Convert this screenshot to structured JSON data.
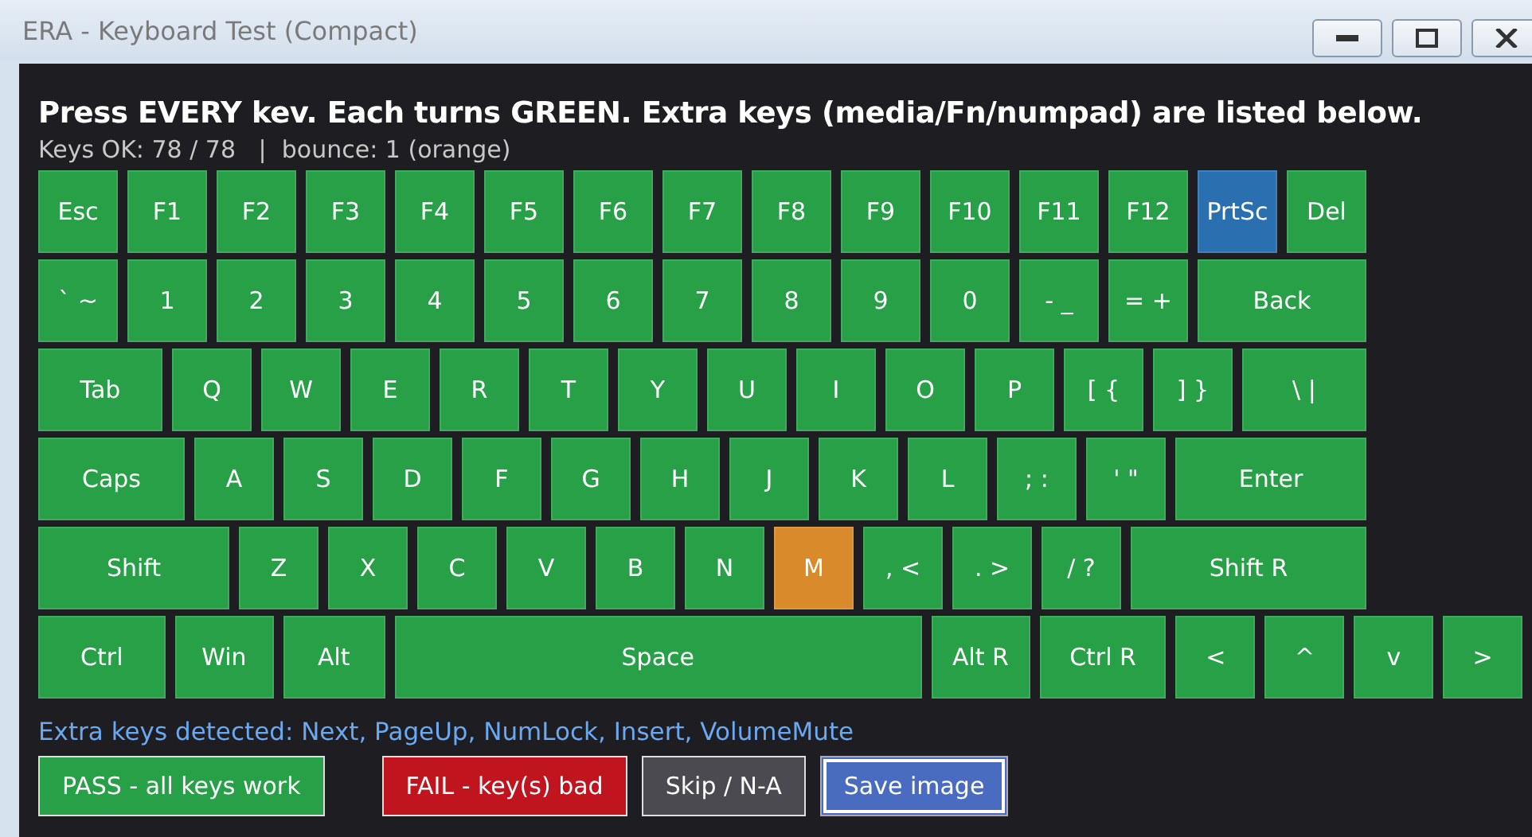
{
  "window": {
    "title": "ERA - Keyboard Test (Compact)"
  },
  "heading": "Press EVERY kev. Each turns GREEN. Extra keys (media/Fn/numpad) are listed below.",
  "status": "Keys OK: 78 / 78   |  bounce: 1 (orange)",
  "keyboard": {
    "rows": [
      {
        "keys": [
          {
            "label": "Esc",
            "color": "#27a047"
          },
          {
            "label": "F1",
            "color": "#27a047"
          },
          {
            "label": "F2",
            "color": "#27a047"
          },
          {
            "label": "F3",
            "color": "#27a047"
          },
          {
            "label": "F4",
            "color": "#27a047"
          },
          {
            "label": "F5",
            "color": "#27a047"
          },
          {
            "label": "F6",
            "color": "#27a047"
          },
          {
            "label": "F7",
            "color": "#27a047"
          },
          {
            "label": "F8",
            "color": "#27a047"
          },
          {
            "label": "F9",
            "color": "#27a047"
          },
          {
            "label": "F10",
            "color": "#27a047"
          },
          {
            "label": "F11",
            "color": "#27a047"
          },
          {
            "label": "F12",
            "color": "#27a047"
          },
          {
            "label": "PrtSc",
            "color": "#2a6faf"
          },
          {
            "label": "Del",
            "color": "#27a047"
          }
        ]
      },
      {
        "keys": [
          {
            "label": "` ~",
            "color": "#27a047"
          },
          {
            "label": "1",
            "color": "#27a047"
          },
          {
            "label": "2",
            "color": "#27a047"
          },
          {
            "label": "3",
            "color": "#27a047"
          },
          {
            "label": "4",
            "color": "#27a047"
          },
          {
            "label": "5",
            "color": "#27a047"
          },
          {
            "label": "6",
            "color": "#27a047"
          },
          {
            "label": "7",
            "color": "#27a047"
          },
          {
            "label": "8",
            "color": "#27a047"
          },
          {
            "label": "9",
            "color": "#27a047"
          },
          {
            "label": "0",
            "color": "#27a047"
          },
          {
            "label": "- _",
            "color": "#27a047"
          },
          {
            "label": "= +",
            "color": "#27a047"
          },
          {
            "label": "Back",
            "color": "#27a047"
          }
        ]
      },
      {
        "keys": [
          {
            "label": "Tab",
            "color": "#27a047"
          },
          {
            "label": "Q",
            "color": "#27a047"
          },
          {
            "label": "W",
            "color": "#27a047"
          },
          {
            "label": "E",
            "color": "#27a047"
          },
          {
            "label": "R",
            "color": "#27a047"
          },
          {
            "label": "T",
            "color": "#27a047"
          },
          {
            "label": "Y",
            "color": "#27a047"
          },
          {
            "label": "U",
            "color": "#27a047"
          },
          {
            "label": "I",
            "color": "#27a047"
          },
          {
            "label": "O",
            "color": "#27a047"
          },
          {
            "label": "P",
            "color": "#27a047"
          },
          {
            "label": "[ {",
            "color": "#27a047"
          },
          {
            "label": "] }",
            "color": "#27a047"
          },
          {
            "label": "\\ |",
            "color": "#27a047"
          }
        ]
      },
      {
        "keys": [
          {
            "label": "Caps",
            "color": "#27a047"
          },
          {
            "label": "A",
            "color": "#27a047"
          },
          {
            "label": "S",
            "color": "#27a047"
          },
          {
            "label": "D",
            "color": "#27a047"
          },
          {
            "label": "F",
            "color": "#27a047"
          },
          {
            "label": "G",
            "color": "#27a047"
          },
          {
            "label": "H",
            "color": "#27a047"
          },
          {
            "label": "J",
            "color": "#27a047"
          },
          {
            "label": "K",
            "color": "#27a047"
          },
          {
            "label": "L",
            "color": "#27a047"
          },
          {
            "label": "; :",
            "color": "#27a047"
          },
          {
            "label": "' \"",
            "color": "#27a047"
          },
          {
            "label": "Enter",
            "color": "#27a047"
          }
        ]
      },
      {
        "keys": [
          {
            "label": "Shift",
            "color": "#27a047"
          },
          {
            "label": "Z",
            "color": "#27a047"
          },
          {
            "label": "X",
            "color": "#27a047"
          },
          {
            "label": "C",
            "color": "#27a047"
          },
          {
            "label": "V",
            "color": "#27a047"
          },
          {
            "label": "B",
            "color": "#27a047"
          },
          {
            "label": "N",
            "color": "#27a047"
          },
          {
            "label": "M",
            "color": "#d98a2a"
          },
          {
            "label": ", <",
            "color": "#27a047"
          },
          {
            "label": ". >",
            "color": "#27a047"
          },
          {
            "label": "/ ?",
            "color": "#27a047"
          },
          {
            "label": "Shift R",
            "color": "#27a047"
          }
        ]
      },
      {
        "keys": [
          {
            "label": "Ctrl",
            "color": "#27a047"
          },
          {
            "label": "Win",
            "color": "#27a047"
          },
          {
            "label": "Alt",
            "color": "#27a047"
          },
          {
            "label": "Space",
            "color": "#27a047"
          },
          {
            "label": "Alt R",
            "color": "#27a047"
          },
          {
            "label": "Ctrl R",
            "color": "#27a047"
          },
          {
            "label": "<",
            "color": "#27a047"
          },
          {
            "label": "^",
            "color": "#27a047"
          },
          {
            "label": "v",
            "color": "#27a047"
          },
          {
            "label": ">",
            "color": "#27a047"
          }
        ]
      }
    ]
  },
  "extra_keys": "Extra keys detected: Next, PageUp, NumLock, Insert, VolumeMute",
  "buttons": [
    {
      "label": "PASS - all keys work",
      "kind": "pass",
      "focused": false
    },
    {
      "label": "FAIL - key(s) bad",
      "kind": "fail",
      "focused": false
    },
    {
      "label": "Skip / N-A",
      "kind": "skip",
      "focused": false
    },
    {
      "label": "Save image",
      "kind": "save",
      "focused": true
    }
  ]
}
